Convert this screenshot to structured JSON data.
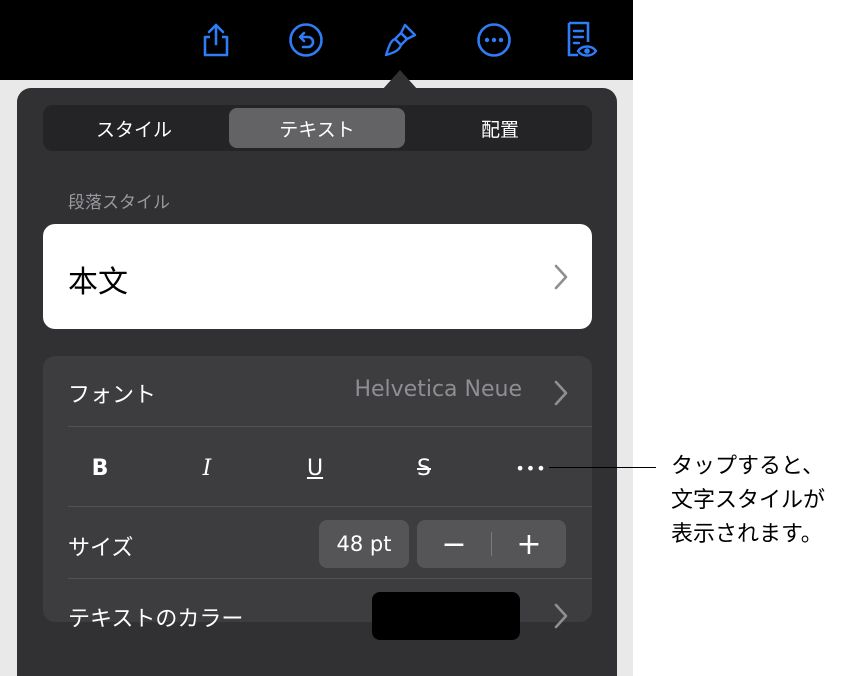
{
  "colors": {
    "toolbar_icon": "#2f7cf6",
    "popover_bg": "#313133",
    "segment_active": "#636366",
    "text_color_swatch": "#000000"
  },
  "toolbar": {
    "icons": [
      "share-icon",
      "undo-icon",
      "format-brush-icon",
      "more-icon",
      "document-view-icon"
    ]
  },
  "tabs": [
    {
      "label": "スタイル",
      "active": false
    },
    {
      "label": "テキスト",
      "active": true
    },
    {
      "label": "配置",
      "active": false
    }
  ],
  "paragraph_style": {
    "section_label": "段落スタイル",
    "current": "本文"
  },
  "font": {
    "label": "フォント",
    "value": "Helvetica Neue"
  },
  "format_buttons": {
    "bold": "B",
    "italic": "I",
    "underline": "U",
    "strikethrough": "S",
    "more": "•••"
  },
  "size": {
    "label": "サイズ",
    "value": "48 pt",
    "decrease": "−",
    "increase": "+"
  },
  "text_color": {
    "label": "テキストのカラー"
  },
  "callout": {
    "lines": [
      "タップすると、",
      "文字スタイルが",
      "表示されます。"
    ]
  }
}
